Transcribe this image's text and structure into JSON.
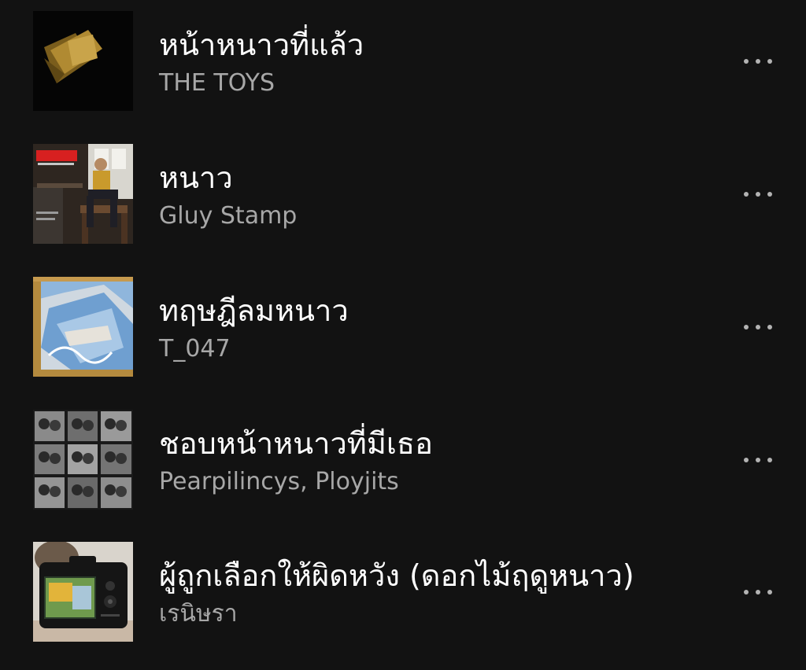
{
  "tracks": [
    {
      "title": "หน้าหนาวที่แล้ว",
      "artist": "THE TOYS",
      "cover": "album-cover-paper"
    },
    {
      "title": "หนาว",
      "artist": "Gluy Stamp",
      "cover": "album-cover-man-sitting"
    },
    {
      "title": "ทฤษฎีลมหนาว",
      "artist": "T_047",
      "cover": "album-cover-blue-painting"
    },
    {
      "title": "ชอบหน้าหนาวที่มีเธอ",
      "artist": "Pearpilincys, Ployjits",
      "cover": "album-cover-photo-grid"
    },
    {
      "title": "ผู้ถูกเลือกให้ผิดหวัง (ดอกไม้ฤดูหนาว)",
      "artist": "เรนิษรา",
      "cover": "album-cover-camera"
    }
  ],
  "more_icon": "more-horizontal-icon",
  "colors": {
    "background": "#121212",
    "title": "#ffffff",
    "artist": "#a7a7a7",
    "more_dots": "#b3b3b3"
  }
}
